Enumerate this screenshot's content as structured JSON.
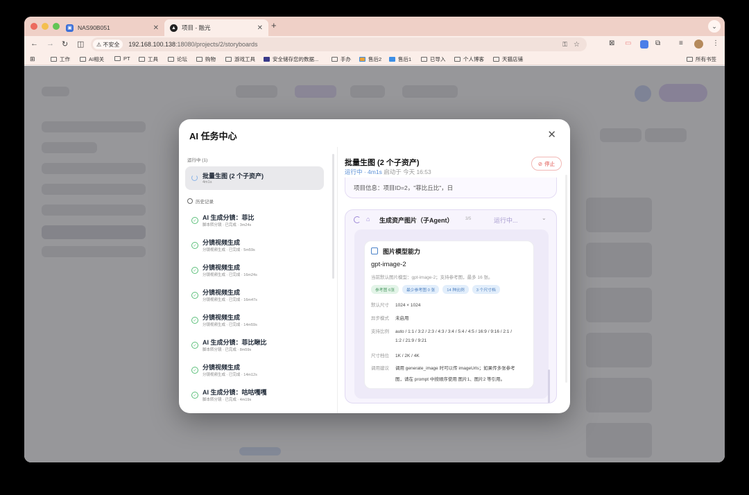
{
  "browser": {
    "tabs": [
      {
        "title": "NAS90B051"
      },
      {
        "title": "项目 - 融光"
      }
    ],
    "address": {
      "security_label": "不安全",
      "host": "192.168.100.138",
      "path": ":18080/projects/2/storyboards"
    },
    "bookmarks": [
      "工作",
      "AI相关",
      "PT",
      "工具",
      "论坛",
      "购物",
      "游戏工具",
      "安全储存您的数据...",
      "手办",
      "售后2",
      "售后1",
      "已导入",
      "个人博客",
      "天猫店铺"
    ],
    "all_bookmarks": "所有书签"
  },
  "modal": {
    "title": "AI 任务中心",
    "running_section": "运行中 (1)",
    "running_item": {
      "title": "批量生图 (2 个子资产)",
      "sub": "4m1s"
    },
    "history_section": "历史记录",
    "history": [
      {
        "title": "AI 生成分镜：菲比",
        "sub": "脚本转分镜 · 已完成 · 3m24s"
      },
      {
        "title": "分镜视频生成",
        "sub": "分镜视频生成 · 已完成 · 5m59s"
      },
      {
        "title": "分镜视频生成",
        "sub": "分镜视频生成 · 已完成 · 16m24s"
      },
      {
        "title": "分镜视频生成",
        "sub": "分镜视频生成 · 已完成 · 16m47s"
      },
      {
        "title": "分镜视频生成",
        "sub": "分镜视频生成 · 已完成 · 14m59s"
      },
      {
        "title": "AI 生成分镜：菲比瞅比",
        "sub": "脚本转分镜 · 已完成 · 8m59s"
      },
      {
        "title": "分镜视频生成",
        "sub": "分镜视频生成 · 已完成 · 14m12s"
      },
      {
        "title": "AI 生成分镜：咕咕嘎嘎",
        "sub": "脚本转分镜 · 已完成 · 4m19s"
      }
    ],
    "detail": {
      "title": "批量生图 (2 个子资产)",
      "status": "运行中 · 4m1s",
      "started": "启动于 今天 16:53",
      "stop_label": "停止",
      "info": "项目信息：项目ID=2，\"菲比丘比\"，日",
      "agent": {
        "title": "生成资产图片（子Agent）",
        "progress": "3/5",
        "state": "运行中..."
      },
      "card": {
        "title": "图片模型能力",
        "model": "gpt-image-2",
        "desc": "当前默认图片模型：gpt-image-2；支持参考图，最多 16 张。",
        "tags": [
          "参考图 6张",
          "最少参考图 0 张",
          "14 种比例",
          "3 个尺寸档"
        ],
        "rows": [
          {
            "k": "默认尺寸",
            "v": "1024 × 1024"
          },
          {
            "k": "异步模式",
            "v": "未启用"
          },
          {
            "k": "支持比例",
            "v": "auto / 1:1 / 3:2 / 2:3 / 4:3 / 3:4 / 5:4 / 4:5 / 16:9 / 9:16 / 2:1 /",
            "v2": "1:2 / 21:9 / 9:21"
          },
          {
            "k": "尺寸档位",
            "v": "1K / 2K / 4K"
          },
          {
            "k": "调用建议",
            "v": "调用 generate_image 时可以传 imageUrls；如果传多张参考",
            "v2": "图，请在 prompt 中按顺序使用 图片1、图片2 等引用。"
          }
        ]
      }
    }
  }
}
